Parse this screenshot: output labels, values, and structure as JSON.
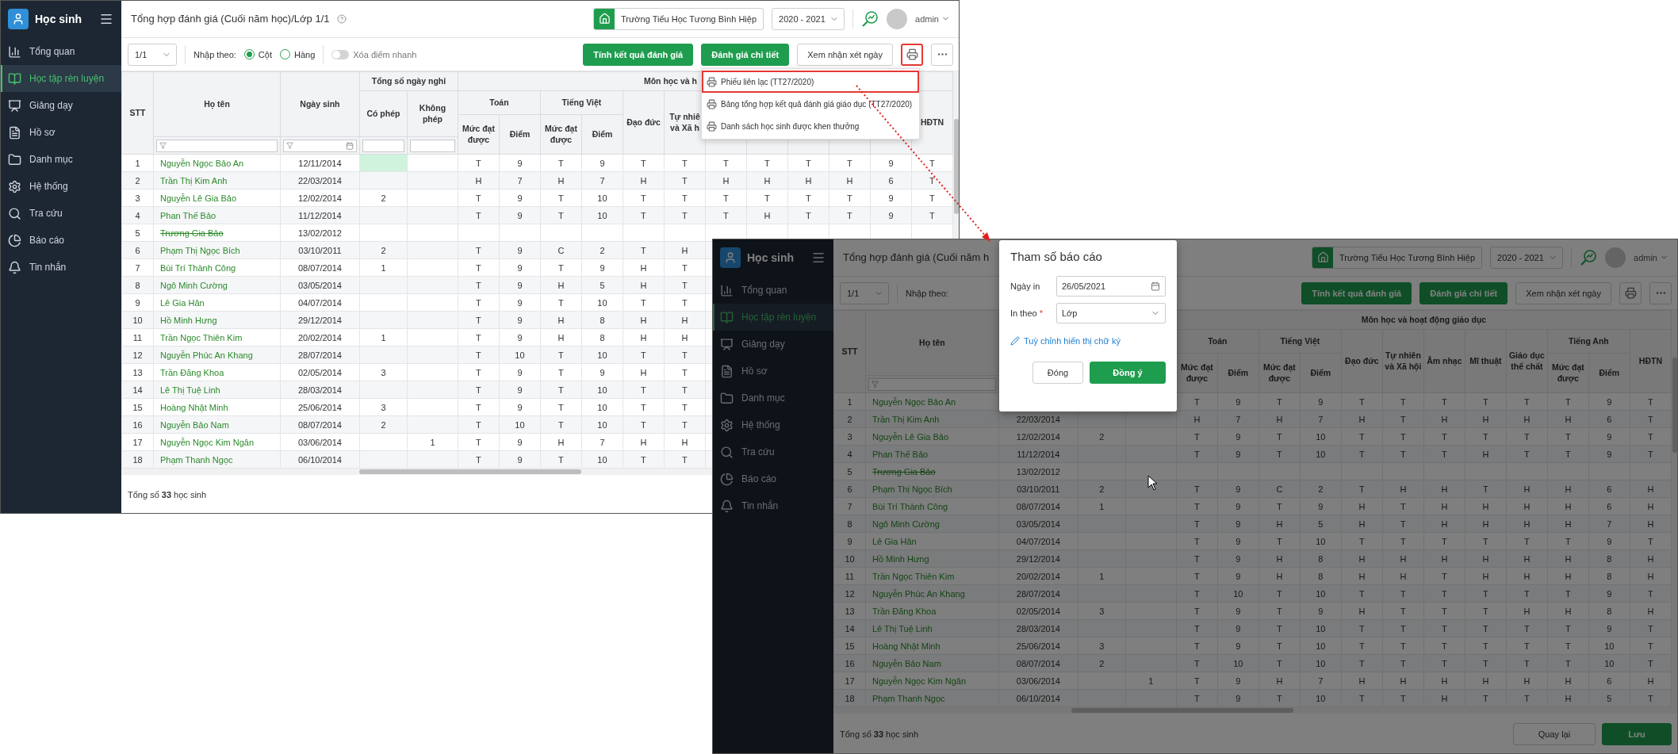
{
  "left_window": {
    "sidebar": {
      "title": "Học sinh",
      "items": [
        {
          "label": "Tổng quan",
          "selected": false
        },
        {
          "label": "Học tập rèn luyện",
          "selected": true
        },
        {
          "label": "Giảng dạy",
          "selected": false
        },
        {
          "label": "Hồ sơ",
          "selected": false
        },
        {
          "label": "Danh mục",
          "selected": false
        },
        {
          "label": "Hệ thống",
          "selected": false
        },
        {
          "label": "Tra cứu",
          "selected": false
        },
        {
          "label": "Báo cáo",
          "selected": false
        },
        {
          "label": "Tin nhắn",
          "selected": false
        }
      ]
    },
    "header": {
      "title": "Tổng hợp đánh giá (Cuối năm học)/Lớp 1/1",
      "help": true,
      "school": "Trường Tiểu Học Tương Bình Hiệp",
      "year": "2020 - 2021",
      "user": "admin"
    },
    "toolbar": {
      "page": "1/1",
      "input_by": "Nhập theo:",
      "radios": [
        {
          "label": "Cột",
          "selected": true
        },
        {
          "label": "Hàng",
          "selected": false
        }
      ],
      "toggle": {
        "label": "Xóa điểm nhanh",
        "on": false
      },
      "buttons": [
        {
          "label": "Tính kết quả đánh giá",
          "kind": "primary"
        },
        {
          "label": "Đánh giá chi tiết",
          "kind": "primary"
        },
        {
          "label": "Xem nhận xét ngày",
          "kind": "secondary"
        }
      ],
      "print_button": {
        "highlighted": true
      }
    },
    "print_menu": {
      "items": [
        {
          "label": "Phiếu liên lạc (TT27/2020)",
          "highlighted": true
        },
        {
          "label": "Bảng tổng hợp kết quả đánh giá giáo dục (TT27/2020)",
          "highlighted": false
        },
        {
          "label": "Danh sách học sinh được khen thưởng",
          "highlighted": false
        }
      ]
    },
    "table": {
      "headers": {
        "stt": "STT",
        "name": "Họ tên",
        "dob": "Ngày sinh",
        "absence": "Tổng số ngày nghỉ",
        "excused": "Có phép",
        "unexcused": "Không phép",
        "subjects": "Môn học và h",
        "math": "Toán",
        "math_level": "Mức đạt được",
        "math_score": "Điểm",
        "viet": "Tiếng Việt",
        "viet_level": "Mức đạt được",
        "viet_score": "Điểm",
        "ethics": "Đạo đức",
        "nature": "Tự nhiê\nvà Xã h",
        "hdtn": "HĐTN"
      },
      "filters": {
        "name": true,
        "dob": true,
        "absence": true
      },
      "rows": [
        {
          "stt": "1",
          "name": "Nguyễn Ngọc Bảo An",
          "dob": "12/11/2014",
          "struck": false,
          "leave_selected": true,
          "scores": [
            "T",
            "9",
            "T",
            "9",
            "T",
            "T",
            "T",
            "T",
            "T",
            "T",
            "9",
            "T"
          ]
        },
        {
          "stt": "2",
          "name": "Trần Thị Kim Anh",
          "dob": "22/03/2014",
          "struck": false,
          "leave_selected": false,
          "scores": [
            "H",
            "7",
            "H",
            "7",
            "H",
            "T",
            "H",
            "H",
            "H",
            "H",
            "6",
            "T"
          ]
        },
        {
          "stt": "3",
          "name": "Nguyễn Lê Gia Bảo",
          "dob": "12/02/2014",
          "excused": "2",
          "struck": false,
          "leave_selected": false,
          "scores": [
            "T",
            "9",
            "T",
            "10",
            "T",
            "T",
            "T",
            "T",
            "T",
            "T",
            "9",
            "T"
          ]
        },
        {
          "stt": "4",
          "name": "Phan Thế Bảo",
          "dob": "11/12/2014",
          "struck": false,
          "leave_selected": false,
          "scores": [
            "T",
            "9",
            "T",
            "10",
            "T",
            "T",
            "T",
            "H",
            "T",
            "T",
            "9",
            "T"
          ]
        },
        {
          "stt": "5",
          "name": "Trương Gia Bảo",
          "dob": "13/02/2012",
          "struck": true,
          "leave_selected": false
        },
        {
          "stt": "6",
          "name": "Phạm Thị Ngọc Bích",
          "dob": "03/10/2011",
          "excused": "2",
          "struck": false,
          "leave_selected": false,
          "scores": [
            "T",
            "9",
            "C",
            "2",
            "T",
            "H"
          ]
        },
        {
          "stt": "7",
          "name": "Bùi Trí Thành Công",
          "dob": "08/07/2014",
          "excused": "1",
          "struck": false,
          "leave_selected": false,
          "scores": [
            "T",
            "9",
            "T",
            "9",
            "H",
            "T"
          ]
        },
        {
          "stt": "8",
          "name": "Ngô Minh Cường",
          "dob": "03/05/2014",
          "struck": false,
          "leave_selected": false,
          "scores": [
            "T",
            "9",
            "H",
            "5",
            "H",
            "T"
          ]
        },
        {
          "stt": "9",
          "name": "Lê Gia Hân",
          "dob": "04/07/2014",
          "struck": false,
          "leave_selected": false,
          "scores": [
            "T",
            "9",
            "T",
            "10",
            "T",
            "T"
          ]
        },
        {
          "stt": "10",
          "name": "Hồ Minh Hưng",
          "dob": "29/12/2014",
          "struck": false,
          "leave_selected": false,
          "scores": [
            "T",
            "9",
            "H",
            "8",
            "H",
            "H"
          ]
        },
        {
          "stt": "11",
          "name": "Trần Ngọc Thiên Kim",
          "dob": "20/02/2014",
          "excused": "1",
          "struck": false,
          "leave_selected": false,
          "scores": [
            "T",
            "9",
            "H",
            "8",
            "H",
            "H"
          ]
        },
        {
          "stt": "12",
          "name": "Nguyễn Phúc An Khang",
          "dob": "28/07/2014",
          "struck": false,
          "leave_selected": false,
          "scores": [
            "T",
            "10",
            "T",
            "10",
            "T",
            "T"
          ]
        },
        {
          "stt": "13",
          "name": "Trần Đăng Khoa",
          "dob": "02/05/2014",
          "excused": "3",
          "struck": false,
          "leave_selected": false,
          "scores": [
            "T",
            "9",
            "T",
            "9",
            "H",
            "T"
          ]
        },
        {
          "stt": "14",
          "name": "Lê Thị Tuệ Linh",
          "dob": "28/03/2014",
          "struck": false,
          "leave_selected": false,
          "scores": [
            "T",
            "9",
            "T",
            "10",
            "T",
            "T"
          ]
        },
        {
          "stt": "15",
          "name": "Hoàng Nhật Minh",
          "dob": "25/06/2014",
          "excused": "3",
          "struck": false,
          "leave_selected": false,
          "scores": [
            "T",
            "9",
            "T",
            "10",
            "T",
            "T"
          ]
        },
        {
          "stt": "16",
          "name": "Nguyễn Bảo Nam",
          "dob": "08/07/2014",
          "excused": "2",
          "struck": false,
          "leave_selected": false,
          "scores": [
            "T",
            "10",
            "T",
            "10",
            "T",
            "T"
          ]
        },
        {
          "stt": "17",
          "name": "Nguyễn Ngọc Kim Ngân",
          "dob": "03/06/2014",
          "unexcused": "1",
          "struck": false,
          "leave_selected": false,
          "scores": [
            "T",
            "9",
            "H",
            "7",
            "H",
            "H"
          ]
        },
        {
          "stt": "18",
          "name": "Phạm Thanh Ngọc",
          "dob": "06/10/2014",
          "struck": false,
          "leave_selected": false,
          "scores": [
            "T",
            "9",
            "T",
            "10",
            "T",
            "T"
          ]
        }
      ]
    },
    "footer": {
      "total": "Tổng số **33** học sinh"
    }
  },
  "right_window": {
    "sidebar": {
      "title": "Học sinh",
      "items": [
        {
          "label": "Tổng quan",
          "selected": false
        },
        {
          "label": "Học tập rèn luyện",
          "selected": true
        },
        {
          "label": "Giảng dạy",
          "selected": false
        },
        {
          "label": "Hồ sơ",
          "selected": false
        },
        {
          "label": "Danh mục",
          "selected": false
        },
        {
          "label": "Hệ thống",
          "selected": false
        },
        {
          "label": "Tra cứu",
          "selected": false
        },
        {
          "label": "Báo cáo",
          "selected": false
        },
        {
          "label": "Tin nhắn",
          "selected": false
        }
      ]
    },
    "header": {
      "title": "Tổng hợp đánh giá (Cuối năm h",
      "school": "Trường Tiểu Học Tương Bình Hiệp",
      "year": "2020 - 2021",
      "user": "admin"
    },
    "toolbar": {
      "page": "1/1",
      "input_by": "Nhập theo:",
      "buttons": [
        {
          "label": "Tính kết quả đánh giá",
          "kind": "primary"
        },
        {
          "label": "Đánh giá chi tiết",
          "kind": "primary"
        },
        {
          "label": "Xem nhận xét ngày",
          "kind": "secondary"
        }
      ],
      "print_button": {
        "highlighted": false
      }
    },
    "table": {
      "headers": {
        "stt": "STT",
        "name": "Họ tên",
        "subjects": "Môn học và hoạt động giáo dục",
        "math": "Toán",
        "math_level": "Mức đạt được",
        "math_score": "Điểm",
        "viet": "Tiếng Việt",
        "viet_level": "Mức đạt được",
        "viet_score": "Điểm",
        "ethics": "Đạo đức",
        "nature": "Tự nhiên và Xã hội",
        "music": "Âm nhạc",
        "art": "Mĩ thuật",
        "pe": "Giáo dục thể chất",
        "english": "Tiếng Anh",
        "eng_level": "Mức đạt được",
        "eng_score": "Điểm",
        "hdtn": "HĐTN"
      },
      "filters": {
        "name": true
      },
      "rows": [
        {
          "stt": "1",
          "name": "Nguyễn Ngọc Bảo An",
          "struck": false,
          "scores": [
            "T",
            "9",
            "T",
            "9",
            "T",
            "T",
            "T",
            "T",
            "T",
            "T",
            "9",
            "T"
          ]
        },
        {
          "stt": "2",
          "name": "Trần Thị Kim Anh",
          "dob": "22/03/2014",
          "struck": false,
          "scores": [
            "H",
            "7",
            "H",
            "7",
            "H",
            "T",
            "H",
            "H",
            "H",
            "H",
            "6",
            "T"
          ]
        },
        {
          "stt": "3",
          "name": "Nguyễn Lê Gia Bảo",
          "dob": "12/02/2014",
          "excused": "2",
          "struck": false,
          "scores": [
            "T",
            "9",
            "T",
            "10",
            "T",
            "T",
            "T",
            "T",
            "T",
            "T",
            "9",
            "T"
          ]
        },
        {
          "stt": "4",
          "name": "Phan Thế Bảo",
          "dob": "11/12/2014",
          "struck": false,
          "scores": [
            "T",
            "9",
            "T",
            "10",
            "T",
            "T",
            "T",
            "H",
            "T",
            "T",
            "9",
            "T"
          ]
        },
        {
          "stt": "5",
          "name": "Trương Gia Bảo",
          "dob": "13/02/2012",
          "struck": true
        },
        {
          "stt": "6",
          "name": "Phạm Thị Ngọc Bích",
          "dob": "03/10/2011",
          "excused": "2",
          "struck": false,
          "scores": [
            "T",
            "9",
            "C",
            "2",
            "T",
            "H",
            "H",
            "T",
            "H",
            "H",
            "6",
            "H"
          ]
        },
        {
          "stt": "7",
          "name": "Bùi Trí Thành Công",
          "dob": "08/07/2014",
          "excused": "1",
          "struck": false,
          "scores": [
            "T",
            "9",
            "T",
            "9",
            "H",
            "T",
            "H",
            "H",
            "H",
            "H",
            "6",
            "H"
          ]
        },
        {
          "stt": "8",
          "name": "Ngô Minh Cường",
          "dob": "03/05/2014",
          "struck": false,
          "scores": [
            "T",
            "9",
            "H",
            "5",
            "H",
            "T",
            "H",
            "H",
            "H",
            "H",
            "7",
            "H"
          ]
        },
        {
          "stt": "9",
          "name": "Lê Gia Hân",
          "dob": "04/07/2014",
          "struck": false,
          "scores": [
            "T",
            "9",
            "T",
            "10",
            "T",
            "T",
            "T",
            "T",
            "T",
            "T",
            "9",
            "T"
          ]
        },
        {
          "stt": "10",
          "name": "Hồ Minh Hưng",
          "dob": "29/12/2014",
          "struck": false,
          "scores": [
            "T",
            "9",
            "H",
            "8",
            "H",
            "H",
            "H",
            "H",
            "H",
            "H",
            "8",
            "H"
          ]
        },
        {
          "stt": "11",
          "name": "Trần Ngọc Thiên Kim",
          "dob": "20/02/2014",
          "excused": "1",
          "struck": false,
          "scores": [
            "T",
            "9",
            "H",
            "8",
            "H",
            "H",
            "T",
            "H",
            "H",
            "H",
            "8",
            "H"
          ]
        },
        {
          "stt": "12",
          "name": "Nguyễn Phúc An Khang",
          "dob": "28/07/2014",
          "struck": false,
          "scores": [
            "T",
            "10",
            "T",
            "10",
            "T",
            "T",
            "T",
            "T",
            "T",
            "T",
            "9",
            "T"
          ]
        },
        {
          "stt": "13",
          "name": "Trần Đăng Khoa",
          "dob": "02/05/2014",
          "excused": "3",
          "struck": false,
          "scores": [
            "T",
            "9",
            "T",
            "9",
            "H",
            "T",
            "T",
            "T",
            "H",
            "H",
            "8",
            "H"
          ]
        },
        {
          "stt": "14",
          "name": "Lê Thị Tuệ Linh",
          "dob": "28/03/2014",
          "struck": false,
          "scores": [
            "T",
            "9",
            "T",
            "10",
            "T",
            "T",
            "T",
            "T",
            "T",
            "T",
            "9",
            "T"
          ]
        },
        {
          "stt": "15",
          "name": "Hoàng Nhật Minh",
          "dob": "25/06/2014",
          "excused": "3",
          "struck": false,
          "scores": [
            "T",
            "9",
            "T",
            "10",
            "T",
            "T",
            "T",
            "T",
            "T",
            "T",
            "10",
            "T"
          ]
        },
        {
          "stt": "16",
          "name": "Nguyễn Bảo Nam",
          "dob": "08/07/2014",
          "excused": "2",
          "struck": false,
          "scores": [
            "T",
            "10",
            "T",
            "10",
            "T",
            "T",
            "T",
            "T",
            "T",
            "T",
            "10",
            "T"
          ]
        },
        {
          "stt": "17",
          "name": "Nguyễn Ngọc Kim Ngân",
          "dob": "03/06/2014",
          "unexcused": "1",
          "struck": false,
          "scores": [
            "T",
            "9",
            "H",
            "7",
            "H",
            "H",
            "H",
            "H",
            "H",
            "H",
            "6",
            "H"
          ]
        },
        {
          "stt": "18",
          "name": "Phạm Thanh Ngọc",
          "dob": "06/10/2014",
          "struck": false,
          "scores": [
            "T",
            "9",
            "T",
            "10",
            "T",
            "T",
            "H",
            "T",
            "T",
            "H",
            "5",
            "T"
          ]
        }
      ]
    },
    "footer": {
      "total": "Tổng số **33** học sinh",
      "buttons": [
        {
          "label": "Quay lại",
          "kind": "secondary"
        },
        {
          "label": "Lưu",
          "kind": "primary"
        }
      ]
    },
    "dialog": {
      "title": "Tham số báo cáo",
      "fields": [
        {
          "label": "Ngày in",
          "value": "26/05/2021",
          "kind": "date"
        },
        {
          "label": "In theo",
          "required_mark": "*",
          "value": "Lớp",
          "kind": "select"
        }
      ],
      "link": "Tuỳ chỉnh hiển thị chữ ký",
      "buttons": [
        {
          "label": "Đóng",
          "kind": "secondary"
        },
        {
          "label": "Đồng ý",
          "kind": "primary"
        }
      ]
    }
  }
}
